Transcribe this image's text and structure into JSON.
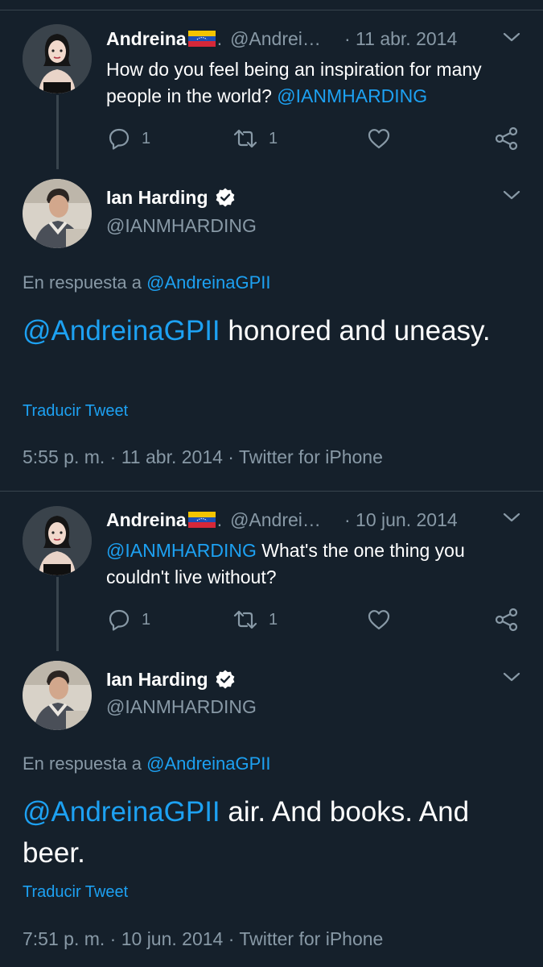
{
  "tweets": [
    {
      "parent": {
        "name": "Andreina",
        "handle": "@Andrei…",
        "date": "· 11 abr. 2014",
        "text": "How do you feel being an inspiration for many people in the world? ",
        "mention": "@IANMHARDING",
        "reply_count": "1",
        "retweet_count": "1"
      },
      "reply": {
        "name": "Ian Harding",
        "handle": "@IANMHARDING",
        "in_reply_prefix": "En respuesta a ",
        "in_reply_user": "@AndreinaGPII",
        "mention": "@AndreinaGPII",
        "text": " honored and uneasy.",
        "translate": "Traducir Tweet",
        "timestamp": "5:55 p. m. · 11 abr. 2014 · Twitter for iPhone"
      }
    },
    {
      "parent": {
        "name": "Andreina",
        "handle": "@Andrei…",
        "date": "· 10 jun. 2014",
        "mention": "@IANMHARDING",
        "text": " What's the one thing you couldn't live without?",
        "reply_count": "1",
        "retweet_count": "1"
      },
      "reply": {
        "name": "Ian Harding",
        "handle": "@IANMHARDING",
        "in_reply_prefix": "En respuesta a ",
        "in_reply_user": "@AndreinaGPII",
        "mention": "@AndreinaGPII",
        "text": " air. And books. And beer.",
        "translate": "Traducir Tweet",
        "timestamp": "7:51 p. m. · 10 jun. 2014 · Twitter for iPhone"
      }
    }
  ],
  "icons": {
    "reply": "reply-icon",
    "retweet": "retweet-icon",
    "like": "heart-icon",
    "share": "share-icon",
    "menu": "chevron-down-icon",
    "verified": "verified-badge-icon",
    "flag": "venezuela-flag-icon"
  },
  "colors": {
    "background": "#15202b",
    "link": "#1da1f2",
    "secondary": "#8899a6",
    "divider": "#38444d"
  }
}
